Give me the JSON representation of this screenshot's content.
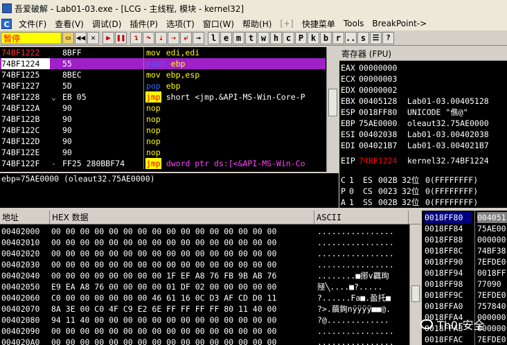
{
  "window": {
    "title": "吾爱破解 - Lab01-03.exe - [LCG - 主线程, 模块 - kernel32]"
  },
  "menu": {
    "items": [
      "文件(F)",
      "查看(V)",
      "调试(D)",
      "插件(P)",
      "选项(T)",
      "窗口(W)",
      "帮助(H)",
      "[+]",
      "快捷菜单",
      "Tools",
      "BreakPoint->"
    ]
  },
  "toolbar": {
    "status": "暂停",
    "letters": [
      "l",
      "e",
      "m",
      "t",
      "w",
      "h",
      "c",
      "P",
      "k",
      "b",
      "r",
      "...",
      "s"
    ]
  },
  "disasm": {
    "rows": [
      {
        "addr": "74BF1222",
        "mark": "",
        "hex": "8BFF",
        "mn": "mov",
        "ops": "edi,edi",
        "mnclass": "mov",
        "opclass": "op-yellow",
        "addr_color": "#ff3030",
        "selected": false
      },
      {
        "addr": "74BF1224",
        "mark": "",
        "hex": "55",
        "mn": "push",
        "ops": "ebp",
        "mnclass": "push",
        "opclass": "op-yellow",
        "addr_color": "#000000",
        "selected": true
      },
      {
        "addr": "74BF1225",
        "mark": "",
        "hex": "8BEC",
        "mn": "mov",
        "ops": "ebp,esp",
        "mnclass": "mov",
        "opclass": "op-yellow",
        "addr_color": "#ffffff",
        "selected": false
      },
      {
        "addr": "74BF1227",
        "mark": "",
        "hex": "5D",
        "mn": "pop",
        "ops": "ebp",
        "mnclass": "pop",
        "opclass": "op-yellow",
        "addr_color": "#ffffff",
        "selected": false
      },
      {
        "addr": "74BF1228",
        "mark": "⌄",
        "hex": "EB 05",
        "mn": "jmp",
        "ops": "short <jmp.&API-MS-Win-Core-P",
        "mnclass": "jmp",
        "opclass": "op-white",
        "addr_color": "#ffffff",
        "selected": false
      },
      {
        "addr": "74BF122A",
        "mark": "",
        "hex": "90",
        "mn": "nop",
        "ops": "",
        "mnclass": "nop",
        "opclass": "op-white",
        "addr_color": "#ffffff",
        "selected": false
      },
      {
        "addr": "74BF122B",
        "mark": "",
        "hex": "90",
        "mn": "nop",
        "ops": "",
        "mnclass": "nop",
        "opclass": "op-white",
        "addr_color": "#ffffff",
        "selected": false
      },
      {
        "addr": "74BF122C",
        "mark": "",
        "hex": "90",
        "mn": "nop",
        "ops": "",
        "mnclass": "nop",
        "opclass": "op-white",
        "addr_color": "#ffffff",
        "selected": false
      },
      {
        "addr": "74BF122D",
        "mark": "",
        "hex": "90",
        "mn": "nop",
        "ops": "",
        "mnclass": "nop",
        "opclass": "op-white",
        "addr_color": "#ffffff",
        "selected": false
      },
      {
        "addr": "74BF122E",
        "mark": "",
        "hex": "90",
        "mn": "nop",
        "ops": "",
        "mnclass": "nop",
        "opclass": "op-white",
        "addr_color": "#ffffff",
        "selected": false
      },
      {
        "addr": "74BF122F",
        "mark": "-",
        "hex": "FF25 280BBF74",
        "mn": "jmp",
        "ops": "dword ptr ds:[<&API-MS-Win-Co",
        "mnclass": "jmp",
        "opclass": "op-pink",
        "addr_color": "#ffffff",
        "selected": false
      }
    ]
  },
  "info": {
    "text": "ebp=75AE0000 (oleaut32.75AE0000)"
  },
  "registers": {
    "header": "寄存器 (FPU)",
    "rows": [
      {
        "name": "EAX",
        "val": "00000000",
        "desc": "",
        "red": false
      },
      {
        "name": "ECX",
        "val": "00000003",
        "desc": "",
        "red": false
      },
      {
        "name": "EDX",
        "val": "00000002",
        "desc": "",
        "red": false
      },
      {
        "name": "EBX",
        "val": "00405128",
        "desc": "Lab01-03.00405128",
        "red": false
      },
      {
        "name": "ESP",
        "val": "0018FF80",
        "desc": "UNICODE \"僬@\"",
        "red": false
      },
      {
        "name": "EBP",
        "val": "75AE0000",
        "desc": "oleaut32.75AE0000",
        "red": false
      },
      {
        "name": "ESI",
        "val": "00402038",
        "desc": "Lab01-03.00402038",
        "red": false
      },
      {
        "name": "EDI",
        "val": "004021B7",
        "desc": "Lab01-03.004021B7",
        "red": false
      }
    ],
    "eip": {
      "name": "EIP",
      "val": "74BF1224",
      "desc": "kernel32.74BF1224",
      "red": true
    },
    "flags": [
      {
        "flag": "C",
        "bit": "1",
        "seg": "ES",
        "val": "002B",
        "info": "32位",
        "lim": "0(FFFFFFFF)"
      },
      {
        "flag": "P",
        "bit": "0",
        "seg": "CS",
        "val": "0023",
        "info": "32位",
        "lim": "0(FFFFFFFF)"
      },
      {
        "flag": "A",
        "bit": "1",
        "seg": "SS",
        "val": "002B",
        "info": "32位",
        "lim": "0(FFFFFFFF)"
      }
    ]
  },
  "dump": {
    "col_addr": "地址",
    "col_hex": "HEX 数据",
    "col_ascii": "ASCII",
    "rows": [
      {
        "addr": "00402000",
        "hex": "00 00 00 00 00 00 00 00 00 00 00 00 00 00 00 00",
        "ascii": "................"
      },
      {
        "addr": "00402010",
        "hex": "00 00 00 00 00 00 00 00 00 00 00 00 00 00 00 00",
        "ascii": "................"
      },
      {
        "addr": "00402020",
        "hex": "00 00 00 00 00 00 00 00 00 00 00 00 00 00 00 00",
        "ascii": "................"
      },
      {
        "addr": "00402030",
        "hex": "00 00 00 00 00 00 00 00 00 00 00 00 00 00 00 00",
        "ascii": "................"
      },
      {
        "addr": "00402040",
        "hex": "00 00 00 00 00 00 00 00 1F EF A8 76 FB 9B AB 76",
        "ascii": "........■捓v覊珣"
      },
      {
        "addr": "00402050",
        "hex": "E9 EA A8 76 00 00 00 00 01 DF 02 00 00 00 00 00",
        "ascii": "殛╲....■?....."
      },
      {
        "addr": "00402060",
        "hex": "C0 00 00 00 00 00 00 46 61 16 0C D3 AF CD D0 11",
        "ascii": "?......Fa■.盈托■"
      },
      {
        "addr": "00402070",
        "hex": "8A 3E 00 C0 4F C9 E2 6E FF FF FF FF 80 11 40 00",
        "ascii": "?>.繭銁nÿÿÿÿ■■@."
      },
      {
        "addr": "00402080",
        "hex": "94 11 40 00 00 00 00 00 00 00 00 00 00 00 00 00",
        "ascii": "?@............."
      },
      {
        "addr": "00402090",
        "hex": "00 00 00 00 00 00 00 00 00 00 00 00 00 00 00 00",
        "ascii": "................"
      },
      {
        "addr": "004020A0",
        "hex": "00 00 00 00 00 00 00 00 00 00 00 00 00 00 00 00",
        "ascii": "................"
      }
    ]
  },
  "stack": {
    "rows": [
      {
        "addr": "0018FF80",
        "val": "004051",
        "sel": true
      },
      {
        "addr": "0018FF84",
        "val": "75AE00",
        "sel": false
      },
      {
        "addr": "0018FF88",
        "val": "000000",
        "sel": false
      },
      {
        "addr": "0018FF8C",
        "val": "74BF38",
        "sel": false
      },
      {
        "addr": "0018FF90",
        "val": "7EFDE0",
        "sel": false
      },
      {
        "addr": "0018FF94",
        "val": "0018FF",
        "sel": false
      },
      {
        "addr": "0018FF98",
        "val": "77090",
        "sel": false
      },
      {
        "addr": "0018FF9C",
        "val": "7EFDE0",
        "sel": false
      },
      {
        "addr": "0018FFA0",
        "val": "757840",
        "sel": false
      },
      {
        "addr": "0018FFA4",
        "val": "000000",
        "sel": false
      },
      {
        "addr": "0018FFA8",
        "val": "000000",
        "sel": false
      },
      {
        "addr": "0018FFAC",
        "val": "7EFDE0",
        "sel": false
      }
    ]
  },
  "watermark": {
    "text": "Th0r安全"
  }
}
